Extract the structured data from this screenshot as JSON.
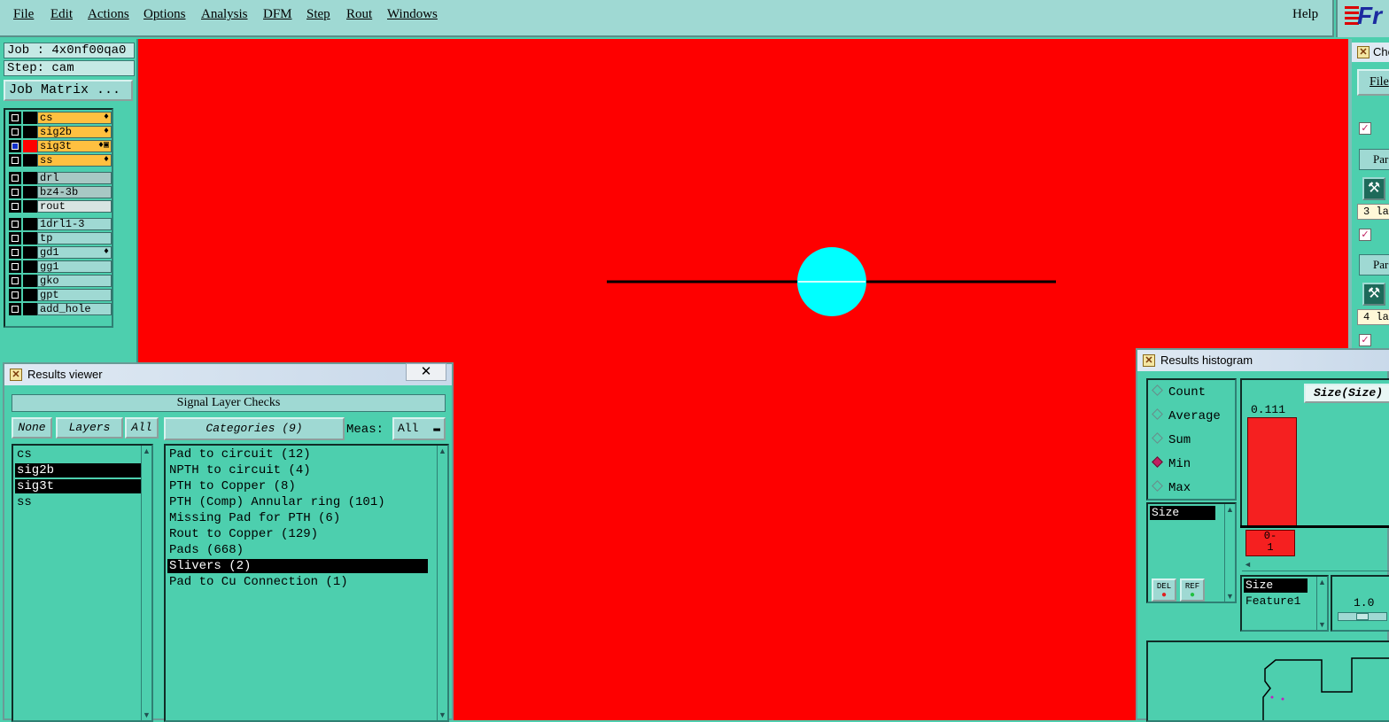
{
  "menubar": {
    "items": [
      "File",
      "Edit",
      "Actions",
      "Options",
      "Analysis",
      "DFM",
      "Step",
      "Rout",
      "Windows"
    ],
    "help": "Help",
    "logo": "Fr"
  },
  "job": {
    "job_line": "Job : 4x0nf00qa0",
    "step_line": "Step: cam",
    "matrix_button": "Job Matrix ..."
  },
  "layers": [
    {
      "name": "cs",
      "color": "#ffc040",
      "mark": "♦"
    },
    {
      "name": "sig2b",
      "color": "#ffc040",
      "mark": "♦"
    },
    {
      "name": "sig3t",
      "color": "#ffc040",
      "mark": "♦▣",
      "active": true
    },
    {
      "name": "ss",
      "color": "#ffc040",
      "mark": "♦"
    },
    {
      "name": "drl",
      "color": "#a8c8c4"
    },
    {
      "name": "bz4-3b",
      "color": "#a8c8c4"
    },
    {
      "name": "rout",
      "color": "#d8e4e2"
    },
    {
      "name": "1drl1-3",
      "color": "#9fd9d3"
    },
    {
      "name": "tp",
      "color": "#9fd9d3"
    },
    {
      "name": "gd1",
      "color": "#9fd9d3",
      "mark": "♦"
    },
    {
      "name": "gg1",
      "color": "#9fd9d3"
    },
    {
      "name": "gko",
      "color": "#9fd9d3"
    },
    {
      "name": "gpt",
      "color": "#9fd9d3"
    },
    {
      "name": "add_hole",
      "color": "#9fd9d3"
    }
  ],
  "canvas": {
    "background": "#fe0000",
    "pad_color": "#00ffff"
  },
  "results_viewer": {
    "title": "Results viewer",
    "close": "✕",
    "header": "Signal Layer Checks",
    "none_btn": "None",
    "layers_btn": "Layers",
    "all_btn": "All",
    "categories_btn": "Categories (9)",
    "meas_label": "Meas:",
    "meas_value": "All",
    "layer_list": [
      {
        "name": "cs",
        "selected": false
      },
      {
        "name": "sig2b",
        "selected": true
      },
      {
        "name": "sig3t",
        "selected": true
      },
      {
        "name": "ss",
        "selected": false
      }
    ],
    "categories": [
      {
        "label": "Pad to circuit (12)",
        "selected": false
      },
      {
        "label": "NPTH to circuit (4)",
        "selected": false
      },
      {
        "label": "PTH to Copper (8)",
        "selected": false
      },
      {
        "label": "PTH (Comp) Annular ring (101)",
        "selected": false
      },
      {
        "label": "Missing Pad for PTH (6)",
        "selected": false
      },
      {
        "label": "Rout to Copper (129)",
        "selected": false
      },
      {
        "label": "Pads (668)",
        "selected": false
      },
      {
        "label": "Slivers (2)",
        "selected": true
      },
      {
        "label": "Pad to Cu Connection (1)",
        "selected": false
      }
    ]
  },
  "histogram": {
    "title": "Results histogram",
    "radios": [
      {
        "label": "Count",
        "on": false
      },
      {
        "label": "Average",
        "on": false
      },
      {
        "label": "Sum",
        "on": false
      },
      {
        "label": "Min",
        "on": true
      },
      {
        "label": "Max",
        "on": false
      }
    ],
    "size_item": "Size",
    "del_btn": "DEL",
    "ref_btn": "REF",
    "chart_title": "Size(Size)",
    "bar_value": "0.111",
    "bar_label": "0-\n1",
    "size_list": [
      "Size",
      "Feature1"
    ],
    "slider_value": "1.0"
  },
  "right_panel": {
    "title_fragment": "Che",
    "file_btn": "File",
    "par1": "Par",
    "layers1": "3 la",
    "par2": "Par",
    "layers2": "4 la"
  }
}
